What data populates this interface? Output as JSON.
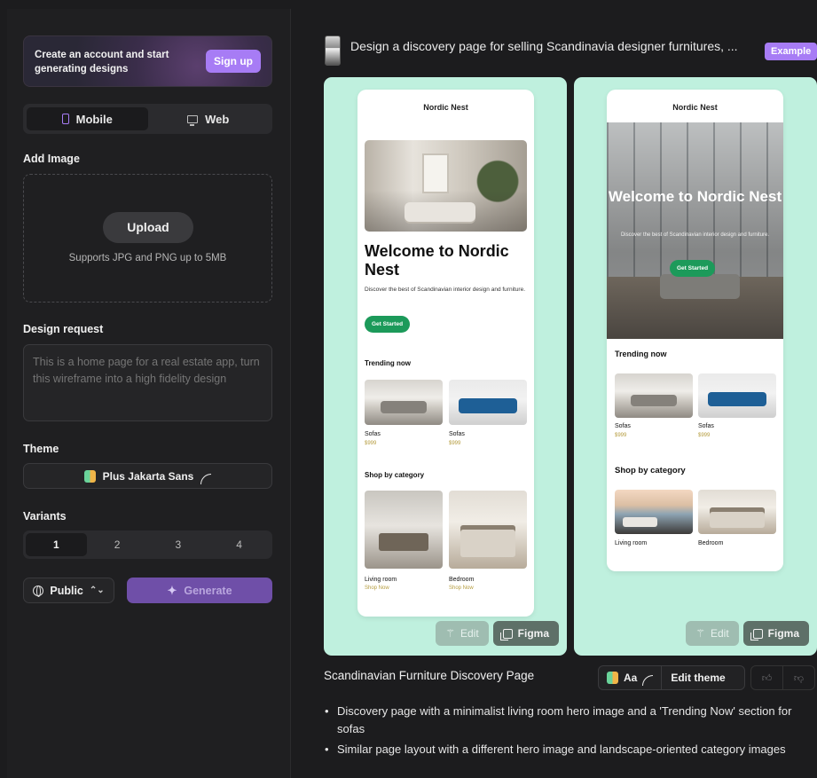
{
  "sidebar": {
    "promo": {
      "text": "Create an account and start generating designs",
      "signup_label": "Sign up"
    },
    "platform_toggle": {
      "mobile_label": "Mobile",
      "web_label": "Web",
      "selected": "Mobile"
    },
    "add_image": {
      "label": "Add Image",
      "upload_label": "Upload",
      "hint": "Supports JPG and PNG up to 5MB"
    },
    "design_request": {
      "label": "Design request",
      "placeholder": "This is a home page for a real estate app, turn this wireframe into a high fidelity design"
    },
    "theme": {
      "label": "Theme",
      "font_name": "Plus Jakarta Sans"
    },
    "variants": {
      "label": "Variants",
      "options": [
        "1",
        "2",
        "3",
        "4"
      ],
      "selected": "1"
    },
    "visibility": {
      "label": "Public"
    },
    "generate_label": "Generate"
  },
  "main": {
    "request_text": "Design a discovery page for selling Scandinavia designer furnitures, ...",
    "example_badge": "Example",
    "variant_a": {
      "brand": "Nordic Nest",
      "headline": "Welcome to Nordic Nest",
      "subtext": "Discover the best of Scandinavian interior design and furniture.",
      "cta": "Get Started",
      "trending_title": "Trending now",
      "trending": [
        {
          "name": "Sofas",
          "price": "$999"
        },
        {
          "name": "Sofas",
          "price": "$999"
        }
      ],
      "category_title": "Shop by category",
      "categories": [
        {
          "name": "Living room",
          "link": "Shop Now"
        },
        {
          "name": "Bedroom",
          "link": "Shop Now"
        }
      ],
      "edit_label": "Edit",
      "figma_label": "Figma"
    },
    "variant_b": {
      "brand": "Nordic Nest",
      "headline": "Welcome to Nordic Nest",
      "subtext": "Discover the best of Scandinavian interior design and furniture.",
      "cta": "Get Started",
      "trending_title": "Trending now",
      "trending": [
        {
          "name": "Sofas",
          "price": "$999"
        },
        {
          "name": "Sofas",
          "price": "$999"
        }
      ],
      "category_title": "Shop by category",
      "categories": [
        {
          "name": "Living room"
        },
        {
          "name": "Bedroom"
        }
      ],
      "edit_label": "Edit",
      "figma_label": "Figma"
    },
    "result": {
      "title": "Scandinavian Furniture Discovery Page",
      "theme_short": "Aa",
      "edit_theme_label": "Edit theme",
      "bullets": [
        "Discovery page with a minimalist living room hero image and a 'Trending Now' section for sofas",
        "Similar page layout with a different hero image and landscape-oriented category images"
      ]
    }
  },
  "colors": {
    "accent": "#a77cf5",
    "card_bg": "#bff0de",
    "cta_green": "#1c9a5a",
    "price_gold": "#b59c3e",
    "dark_bg": "#1c1c1e"
  }
}
